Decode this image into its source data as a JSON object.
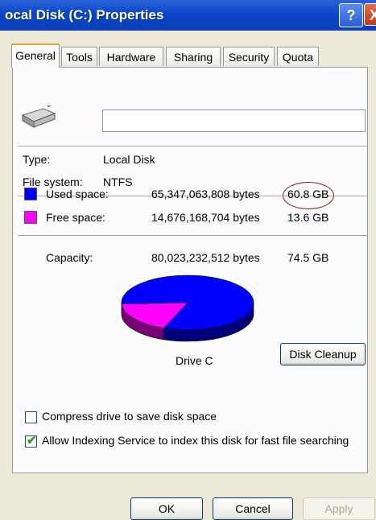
{
  "window": {
    "title": "ocal Disk (C:) Properties",
    "help_glyph": "?",
    "close_glyph": "X"
  },
  "tabs": [
    {
      "label": "General",
      "active": true
    },
    {
      "label": "Tools"
    },
    {
      "label": "Hardware"
    },
    {
      "label": "Sharing"
    },
    {
      "label": "Security"
    },
    {
      "label": "Quota"
    }
  ],
  "general": {
    "drive_icon": "hard-drive-icon",
    "volume_label_value": "",
    "type_label": "Type:",
    "type_value": "Local Disk",
    "fs_label": "File system:",
    "fs_value": "NTFS",
    "used": {
      "label": "Used space:",
      "bytes": "65,347,063,808 bytes",
      "size": "60.8 GB",
      "color": "#0000ff"
    },
    "free": {
      "label": "Free space:",
      "bytes": "14,676,168,704 bytes",
      "size": "13.6 GB",
      "color": "#ff00ff"
    },
    "capacity": {
      "label": "Capacity:",
      "bytes": "80,023,232,512 bytes",
      "size": "74.5 GB"
    },
    "drive_name": "Drive C",
    "cleanup_button": "Disk Cleanup",
    "compress": {
      "label": "Compress drive to save disk space",
      "checked": false
    },
    "indexing": {
      "label": "Allow Indexing Service to index this disk for fast file searching",
      "checked": true
    }
  },
  "chart_data": {
    "type": "pie",
    "categories": [
      "Used space",
      "Free space"
    ],
    "values": [
      65347063808,
      14676168704
    ],
    "colors": [
      "#0000ff",
      "#ff00ff"
    ]
  },
  "buttons": {
    "ok": "OK",
    "cancel": "Cancel",
    "apply": "Apply"
  }
}
